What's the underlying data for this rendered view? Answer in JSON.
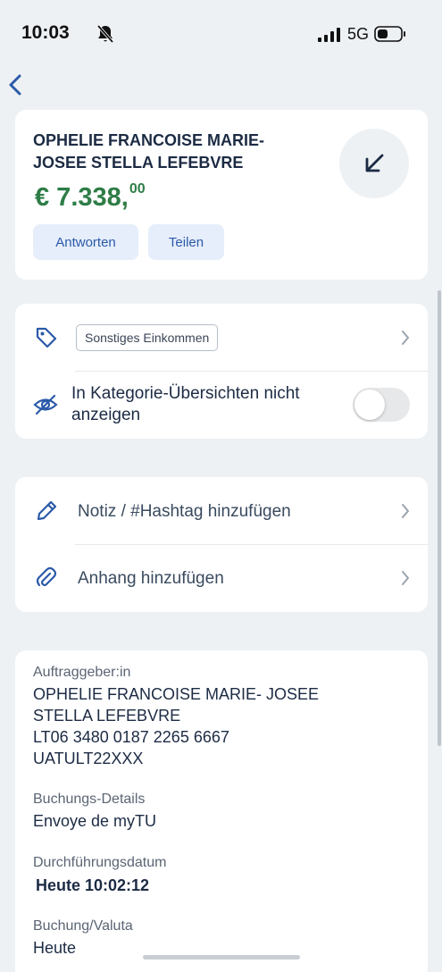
{
  "status_bar": {
    "time": "10:03",
    "network": "5G",
    "icons": [
      "bell-slash-icon",
      "signal-icon",
      "battery-icon"
    ]
  },
  "nav": {
    "back_icon": "chevron-left-icon"
  },
  "transaction": {
    "payer_name": "OPHELIE FRANCOISE MARIE-JOSEE STELLA LEFEBVRE",
    "amount_main": "€ 7.338,",
    "amount_cents": "00",
    "amount_color": "#2e7d46",
    "direction_icon": "arrow-down-left-icon",
    "reply_label": "Antworten",
    "share_label": "Teilen"
  },
  "category": {
    "icon": "tag-icon",
    "tag_label": "Sonstiges Einkommen",
    "hide_label": "In Kategorie-Übersichten nicht anzeigen",
    "hide_icon": "eye-slash-icon",
    "hide_toggle_on": false
  },
  "actions": {
    "note_label": "Notiz / #Hashtag hinzufügen",
    "note_icon": "pencil-icon",
    "attachment_label": "Anhang hinzufügen",
    "attachment_icon": "paperclip-icon"
  },
  "details": {
    "payer_label": "Auftraggeber:in",
    "payer_lines": [
      "OPHELIE FRANCOISE MARIE- JOSEE",
      "STELLA LEFEBVRE",
      "LT06 3480 0187 2265 6667",
      "UATULT22XXX"
    ],
    "booking_details_label": "Buchungs-Details",
    "booking_details_value": "Envoye de myTU",
    "execution_date_label": "Durchführungsdatum",
    "execution_date_value": "Heute 10:02:12",
    "booking_valuta_label": "Buchung/Valuta",
    "booking_valuta_value": "Heute"
  },
  "accent_color": "#2b5aa8"
}
